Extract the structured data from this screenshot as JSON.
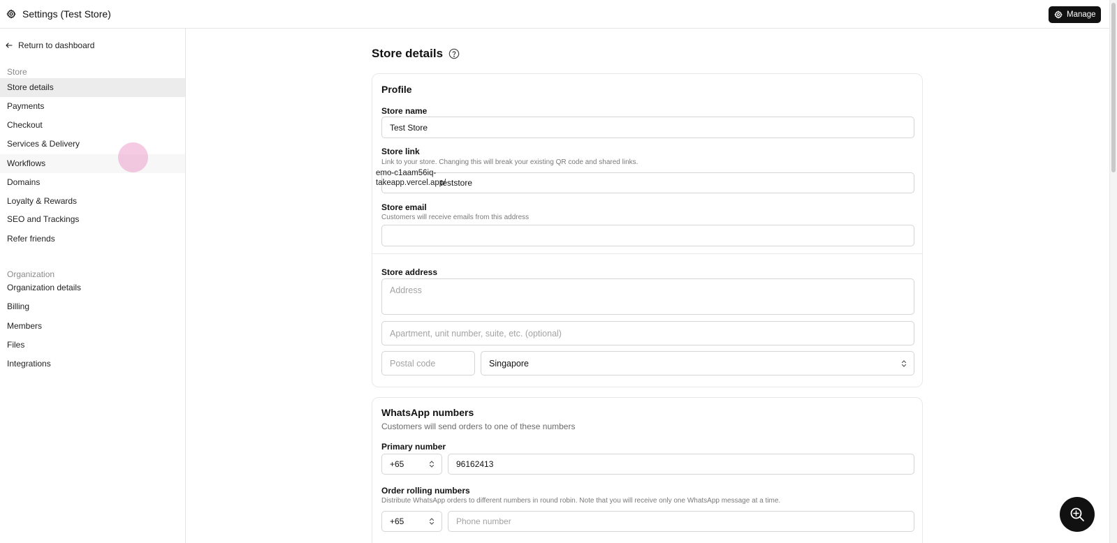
{
  "topbar": {
    "title": "Settings (Test Store)",
    "manage_label": "Manage",
    "settings_icon": "gear-icon"
  },
  "sidebar": {
    "return_label": "Return to dashboard",
    "store_section_label": "Store",
    "store_items": [
      {
        "label": "Store details",
        "active": true
      },
      {
        "label": "Payments"
      },
      {
        "label": "Checkout"
      },
      {
        "label": "Services & Delivery"
      },
      {
        "label": "Workflows"
      },
      {
        "label": "Domains"
      },
      {
        "label": "Loyalty & Rewards"
      },
      {
        "label": "SEO and Trackings"
      },
      {
        "label": "Refer friends"
      }
    ],
    "org_section_label": "Organization",
    "org_items": [
      {
        "label": "Organization details"
      },
      {
        "label": "Billing"
      },
      {
        "label": "Members"
      },
      {
        "label": "Files"
      },
      {
        "label": "Integrations"
      }
    ]
  },
  "page": {
    "title": "Store details",
    "help_icon": "question-circle-icon"
  },
  "profile": {
    "heading": "Profile",
    "store_name_label": "Store name",
    "store_name_value": "Test Store",
    "store_link_label": "Store link",
    "store_link_help": "Link to your store. Changing this will break your existing QR code and shared links.",
    "store_link_prefix": "emo-c1aam56iq-takeapp.vercel.app/",
    "store_link_value": "teststore",
    "store_email_label": "Store email",
    "store_email_help": "Customers will receive emails from this address",
    "store_email_value": "",
    "store_address_label": "Store address",
    "address_placeholder": "Address",
    "apartment_placeholder": "Apartment, unit number, suite, etc. (optional)",
    "postal_placeholder": "Postal code",
    "country_value": "Singapore"
  },
  "whatsapp": {
    "heading": "WhatsApp numbers",
    "subtitle": "Customers will send orders to one of these numbers",
    "primary_label": "Primary number",
    "primary_code": "+65",
    "primary_number": "96162413",
    "rolling_label": "Order rolling numbers",
    "rolling_help": "Distribute WhatsApp orders to different numbers in round robin. Note that you will receive only one WhatsApp message at a time.",
    "rolling_code": "+65",
    "rolling_placeholder": "Phone number"
  },
  "fab": {
    "icon": "zoom-sparkle-icon"
  },
  "colors": {
    "accent": "#111111",
    "active_nav": "#ececec",
    "border": "#d4d4d4"
  }
}
